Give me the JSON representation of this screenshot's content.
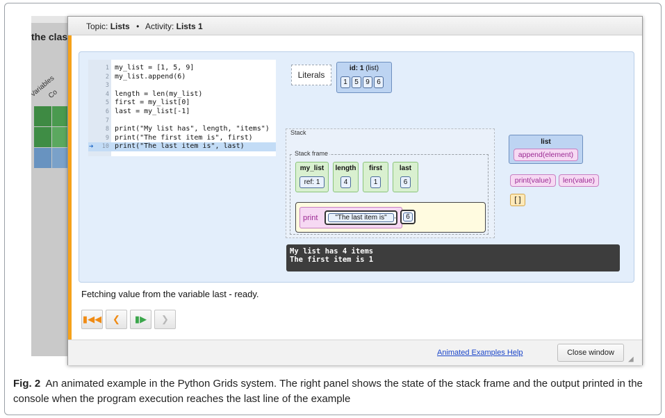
{
  "background_app": {
    "title_fragment": "the class",
    "column_labels": [
      "Variables",
      "Co"
    ],
    "grid_colors": [
      "#3e8a43",
      "#4a9a4f",
      "#3f8d45",
      "#5ba85f",
      "#6893c0",
      "#7aa1c9"
    ]
  },
  "dialog": {
    "topic_label": "Topic:",
    "topic_value": "Lists",
    "separator": "•",
    "activity_label": "Activity:",
    "activity_value": "Lists 1",
    "accent_color": "#f5a21a"
  },
  "code": {
    "current_line": 10,
    "lines": [
      {
        "num": "1",
        "text": "my_list = [1, 5, 9]"
      },
      {
        "num": "2",
        "text": "my_list.append(6)"
      },
      {
        "num": "3",
        "text": ""
      },
      {
        "num": "4",
        "text": "length = len(my_list)"
      },
      {
        "num": "5",
        "text": "first = my_list[0]"
      },
      {
        "num": "6",
        "text": "last = my_list[-1]"
      },
      {
        "num": "7",
        "text": ""
      },
      {
        "num": "8",
        "text": "print(\"My list has\", length, \"items\")"
      },
      {
        "num": "9",
        "text": "print(\"The first item is\", first)"
      },
      {
        "num": "10",
        "text": "print(\"The last item is\", last)"
      }
    ]
  },
  "literals": {
    "label": "Literals",
    "list_object": {
      "id_label": "id: 1",
      "type_label": "(list)",
      "items": [
        "1",
        "5",
        "9",
        "6"
      ]
    }
  },
  "stack": {
    "label": "Stack",
    "frame_label": "Stack frame",
    "variables": [
      {
        "name": "my_list",
        "value": "ref: 1"
      },
      {
        "name": "length",
        "value": "4"
      },
      {
        "name": "first",
        "value": "1"
      },
      {
        "name": "last",
        "value": "6"
      }
    ],
    "call": {
      "function": "print",
      "args": [
        "\"The last item is\"",
        "6"
      ],
      "separator": ","
    }
  },
  "console": {
    "lines": [
      "My list has 4 items",
      "The first item is 1"
    ]
  },
  "palette": {
    "class_name": "list",
    "methods": [
      "append(element)"
    ],
    "functions": [
      "print(value)",
      "len(value)"
    ],
    "empty_list": "[ ]"
  },
  "status": {
    "message": "Fetching value from the variable last - ready."
  },
  "navigation": {
    "first_icon": "skip-to-start-icon",
    "back_icon": "step-back-icon",
    "step_icon": "step-forward-icon",
    "next_icon": "next-icon"
  },
  "footer": {
    "help_link": "Animated Examples Help",
    "close_button": "Close window"
  },
  "caption": {
    "label": "Fig. 2",
    "text": "An animated example in the Python Grids system. The right panel shows the state of the stack frame and the output printed in the console when the program execution reaches the last line of the example"
  }
}
